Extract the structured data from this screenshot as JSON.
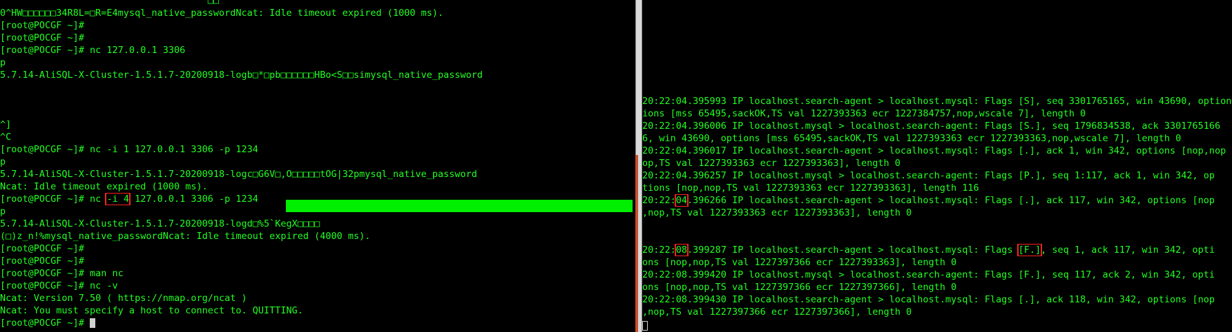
{
  "left_terminal": {
    "lines": [
      {
        "text": "                                     □□"
      },
      {
        "text": "0^HW□□□□□□34R8L=□R=E4mysql_native_passwordNcat: Idle timeout expired (1000 ms)."
      },
      {
        "text": "[root@POCGF ~]#"
      },
      {
        "text": "[root@POCGF ~]#"
      },
      {
        "text": "[root@POCGF ~]# nc 127.0.0.1 3306"
      },
      {
        "text": "p"
      },
      {
        "text": "5.7.14-AliSQL-X-Cluster-1.5.1.7-20200918-logb□*□pb□□□□□□HBo<S□□simysql_native_password"
      },
      {
        "text": ""
      },
      {
        "text": ""
      },
      {
        "text": ""
      },
      {
        "text": "^]"
      },
      {
        "text": "^C"
      },
      {
        "text": "[root@POCGF ~]# nc -i 1 127.0.0.1 3306 -p 1234"
      },
      {
        "text": "p"
      },
      {
        "text": "5.7.14-AliSQL-X-Cluster-1.5.1.7-20200918-logc□G6V□,O□□□□□tOG|32pmysql_native_password"
      },
      {
        "text": "Ncat: Idle timeout expired (1000 ms)."
      },
      {
        "pre": "[root@POCGF ~]# nc ",
        "hl": "-i 4",
        "post": " 127.0.0.1 3306 -p 1234"
      },
      {
        "text": "p"
      },
      {
        "text": "5.7.14-AliSQL-X-Cluster-1.5.1.7-20200918-logd□%5`KegX□□□□"
      },
      {
        "text": "(□)z_n!%mysql_native_passwordNcat: Idle timeout expired (4000 ms)."
      },
      {
        "text": "[root@POCGF ~]#"
      },
      {
        "text": "[root@POCGF ~]#"
      },
      {
        "text": "[root@POCGF ~]# man nc"
      },
      {
        "text": "[root@POCGF ~]# nc -v"
      },
      {
        "text": "Ncat: Version 7.50 ( https://nmap.org/ncat )"
      },
      {
        "text": "Ncat: You must specify a host to connect to. QUITTING."
      },
      {
        "text": "[root@POCGF ~]# ",
        "cursor": true
      }
    ]
  },
  "right_terminal": {
    "lines": [
      {
        "text": "20:22:04.395993 IP localhost.search-agent > localhost.mysql: Flags [S], seq 3301765165, win 43690, options"
      },
      {
        "text": "ions [mss 65495,sackOK,TS val 1227393363 ecr 1227384757,nop,wscale 7], length 0"
      },
      {
        "text": "20:22:04.396006 IP localhost.mysql > localhost.search-agent: Flags [S.], seq 1796834538, ack 3301765166"
      },
      {
        "text": "6, win 43690, options [mss 65495,sackOK,TS val 1227393363 ecr 1227393363,nop,wscale 7], length 0"
      },
      {
        "text": "20:22:04.396017 IP localhost.search-agent > localhost.mysql: Flags [.], ack 1, win 342, options [nop,nop"
      },
      {
        "text": "op,TS val 1227393363 ecr 1227393363], length 0"
      },
      {
        "text": "20:22:04.396257 IP localhost.mysql > localhost.search-agent: Flags [P.], seq 1:117, ack 1, win 342, op"
      },
      {
        "text": "tions [nop,nop,TS val 1227393363 ecr 1227393363], length 116"
      },
      {
        "pre": "20:22:",
        "hl": "04",
        "post": ".396266 IP localhost.search-agent > localhost.mysql: Flags [.], ack 117, win 342, options [nop"
      },
      {
        "text": ",nop,TS val 1227393363 ecr 1227393363], length 0"
      },
      {
        "text": ""
      },
      {
        "text": ""
      },
      {
        "pre": "20:22:",
        "hl": "08",
        "mid": ".399287 IP localhost.search-agent > localhost.mysql: Flags ",
        "hl2": "[F.]",
        "post": ", seq 1, ack 117, win 342, opti"
      },
      {
        "text": "ons [nop,nop,TS val 1227397366 ecr 1227393363], length 0"
      },
      {
        "text": "20:22:08.399420 IP localhost.mysql > localhost.search-agent: Flags [F.], seq 117, ack 2, win 342, opti"
      },
      {
        "text": "ons [nop,nop,TS val 1227397366 ecr 1227397366], length 0"
      },
      {
        "text": "20:22:08.399430 IP localhost.search-agent > localhost.mysql: Flags [.], ack 118, win 342, options [nop"
      },
      {
        "text": ",nop,TS val 1227397366 ecr 1227397366], length 0"
      }
    ]
  }
}
